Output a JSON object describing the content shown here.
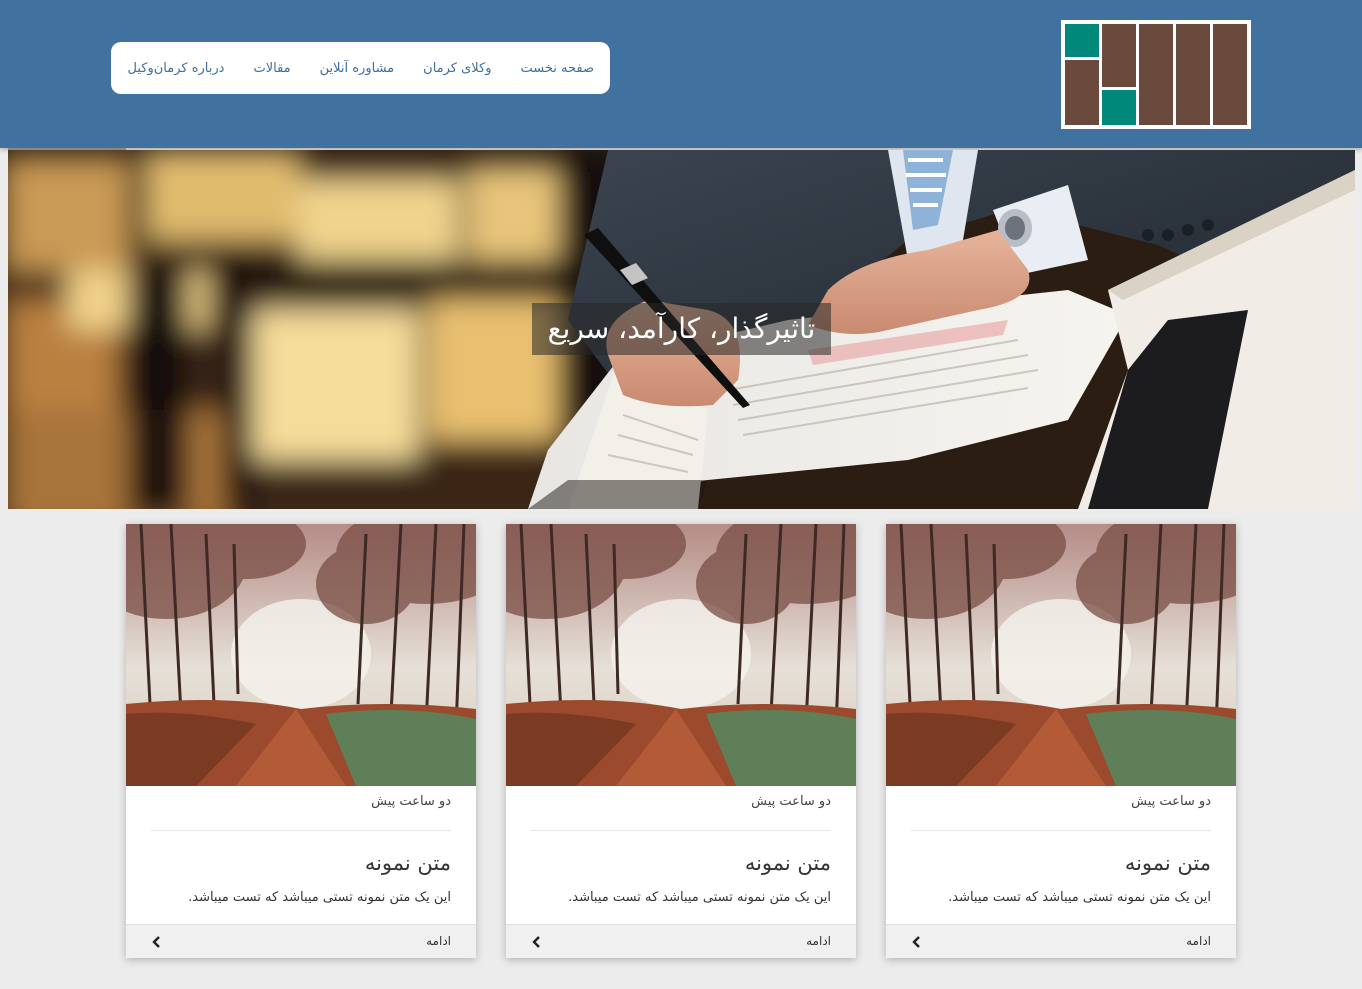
{
  "header": {
    "logo": "site-logo",
    "nav": [
      {
        "label": "صفحه نخست"
      },
      {
        "label": "وکلای کرمان"
      },
      {
        "label": "مشاوره آنلاین"
      },
      {
        "label": "مقالات"
      },
      {
        "label": "درباره کرمان‌وکیل"
      }
    ]
  },
  "hero": {
    "caption": "تاثیرگذار، کارآمد، سریع"
  },
  "cards": [
    {
      "time": "دو ساعت پیش",
      "title": "متن نمونه",
      "text": "این یک متن نمونه تستی میباشد که تست میباشد.",
      "more": "ادامه",
      "icon": "chevron-left-icon"
    },
    {
      "time": "دو ساعت پیش",
      "title": "متن نمونه",
      "text": "این یک متن نمونه تستی میباشد که تست میباشد.",
      "more": "ادامه",
      "icon": "chevron-left-icon"
    },
    {
      "time": "دو ساعت پیش",
      "title": "متن نمونه",
      "text": "این یک متن نمونه تستی میباشد که تست میباشد.",
      "more": "ادامه",
      "icon": "chevron-left-icon"
    }
  ],
  "colors": {
    "header": "#41729f",
    "nav_link": "#3d6ea0",
    "logo_brown": "#6b4a3e",
    "logo_green": "#00897a",
    "page_bg": "#ececec"
  }
}
